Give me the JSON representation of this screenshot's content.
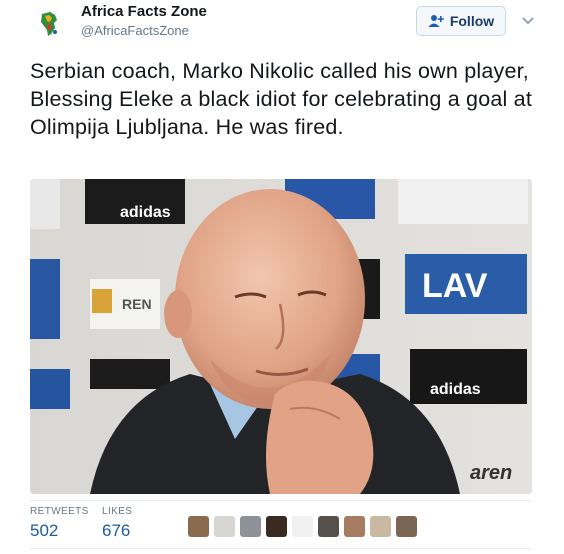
{
  "tweet": {
    "author_name": "Africa Facts Zone",
    "author_handle": "@AfricaFactsZone",
    "follow_label": "Follow",
    "text": "Serbian coach, Marko Nikolic called his own player, Blessing Eleke a black idiot for celebrating a goal at Olimpija Ljubljana. He was fired.",
    "photo_text": {
      "adidas": "adidas",
      "lav": "LAV",
      "arena": "aren",
      "ren": "REN"
    }
  },
  "stats": {
    "retweets_label": "RETWEETS",
    "retweets_value": "502",
    "likes_label": "LIKES",
    "likes_value": "676"
  },
  "colors": {
    "accent": "#1b5c9e",
    "secondary_text": "#657786",
    "follow_button_bg": "#f5f8fa"
  }
}
